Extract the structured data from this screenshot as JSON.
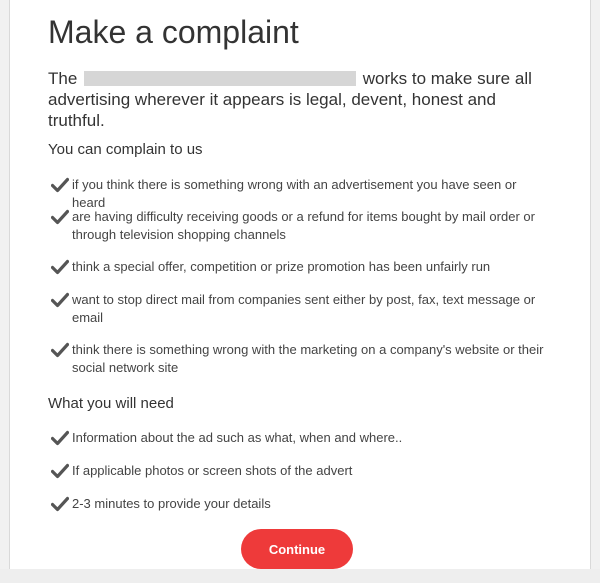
{
  "page": {
    "title": "Make a complaint",
    "intro_prefix": "The ",
    "intro_suffix": " works to make sure all advertising wherever it appears is legal, devent, honest and truthful."
  },
  "complain_section": {
    "heading": "You can complain to us",
    "items": [
      "if you think there is something wrong with an advertisement you have seen or heard",
      "are having difficulty receiving goods or a refund for items bought by mail order or through television shopping channels",
      "think a special offer, competition or prize promotion has been unfairly run",
      "want to stop direct mail from companies sent either by post, fax, text message or email",
      "think there is something wrong with the marketing on a company's website or their social network site"
    ]
  },
  "need_section": {
    "heading": "What you will need",
    "items": [
      "Information about the ad such as what, when and where..",
      "If applicable photos or screen shots of the advert",
      "2-3 minutes to provide your details"
    ]
  },
  "actions": {
    "continue_label": "Continue"
  },
  "colors": {
    "accent": "#ee3a3a",
    "check": "#555555",
    "text": "#333333"
  },
  "icons": {
    "list_marker": "check-icon"
  }
}
